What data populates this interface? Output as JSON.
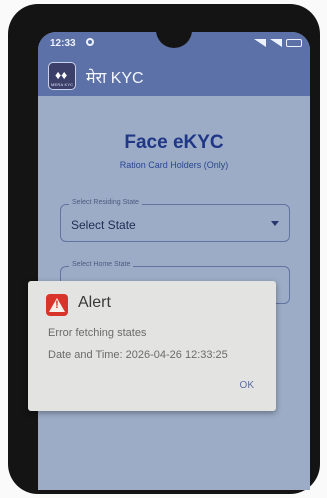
{
  "status_bar": {
    "time": "12:33"
  },
  "app_bar": {
    "title": "मेरा KYC",
    "logo_text": "MERA KYC"
  },
  "main": {
    "heading": "Face eKYC",
    "subheading": "Ration Card Holders (Only)",
    "residing_state": {
      "label": "Select Residing State",
      "value": "Select State"
    },
    "home_state": {
      "label": "Select Home State"
    }
  },
  "alert": {
    "title": "Alert",
    "message": "Error fetching states",
    "datetime": "Date and Time: 2026-04-26 12:33:25",
    "ok_label": "OK"
  },
  "colors": {
    "app_bar": "#5b71a7",
    "heading": "#1f3a8f",
    "alert_icon": "#d9342b"
  }
}
